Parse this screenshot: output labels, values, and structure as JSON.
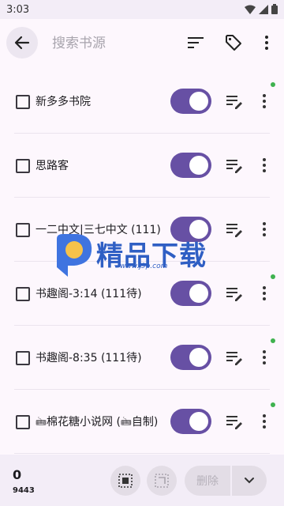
{
  "status": {
    "time": "3:03"
  },
  "search": {
    "placeholder": "搜索书源"
  },
  "sources": [
    {
      "name": "新多多书院",
      "enabled": true,
      "new": true
    },
    {
      "name": "思路客",
      "enabled": true,
      "new": false
    },
    {
      "name": "一二中文|三七中文 (111)",
      "enabled": true,
      "new": false
    },
    {
      "name": "书趣阁-3:14 (111待)",
      "enabled": true,
      "new": true
    },
    {
      "name": "书趣阁-8:35 (111待)",
      "enabled": true,
      "new": true
    },
    {
      "name": "🖮棉花糖小说网 (🖮自制)",
      "enabled": true,
      "new": true
    }
  ],
  "bottom": {
    "selected": "0",
    "total": "9443",
    "delete_label": "删除"
  },
  "watermark": {
    "text": "精品下载",
    "url": "www.j9p.com"
  },
  "colors": {
    "accent": "#6750a4",
    "new_dot": "#3fb24f"
  }
}
